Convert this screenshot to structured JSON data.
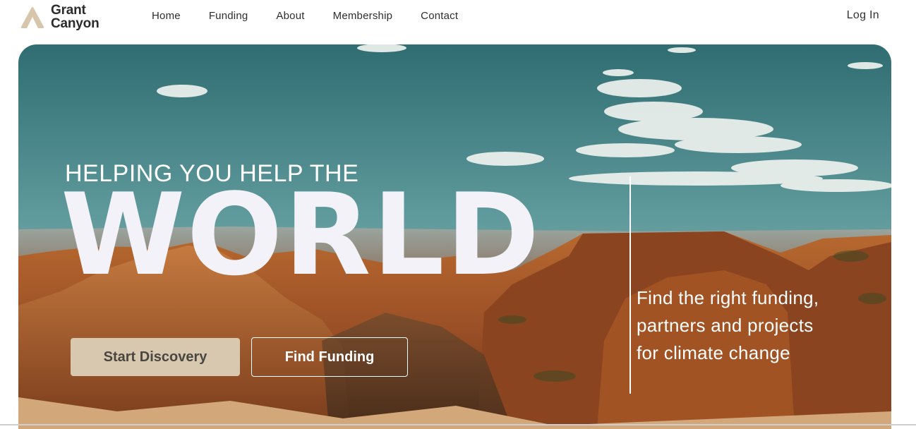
{
  "brand": {
    "name_line1": "Grant",
    "name_line2": "Canyon",
    "logo_color": "#d7c6ac"
  },
  "nav": {
    "items": [
      "Home",
      "Funding",
      "About",
      "Membership",
      "Contact"
    ],
    "login_label": "Log In"
  },
  "hero": {
    "tagline_top": "HELPING YOU HELP THE",
    "tagline_big": "WORLD",
    "side_copy": "Find the right funding, partners and projects for climate change",
    "primary_button": "Start Discovery",
    "secondary_button": "Find Funding",
    "colors": {
      "sky": "#3f7f85",
      "canyon": "#a9582b",
      "button_primary_bg": "#d8c8b0"
    }
  }
}
